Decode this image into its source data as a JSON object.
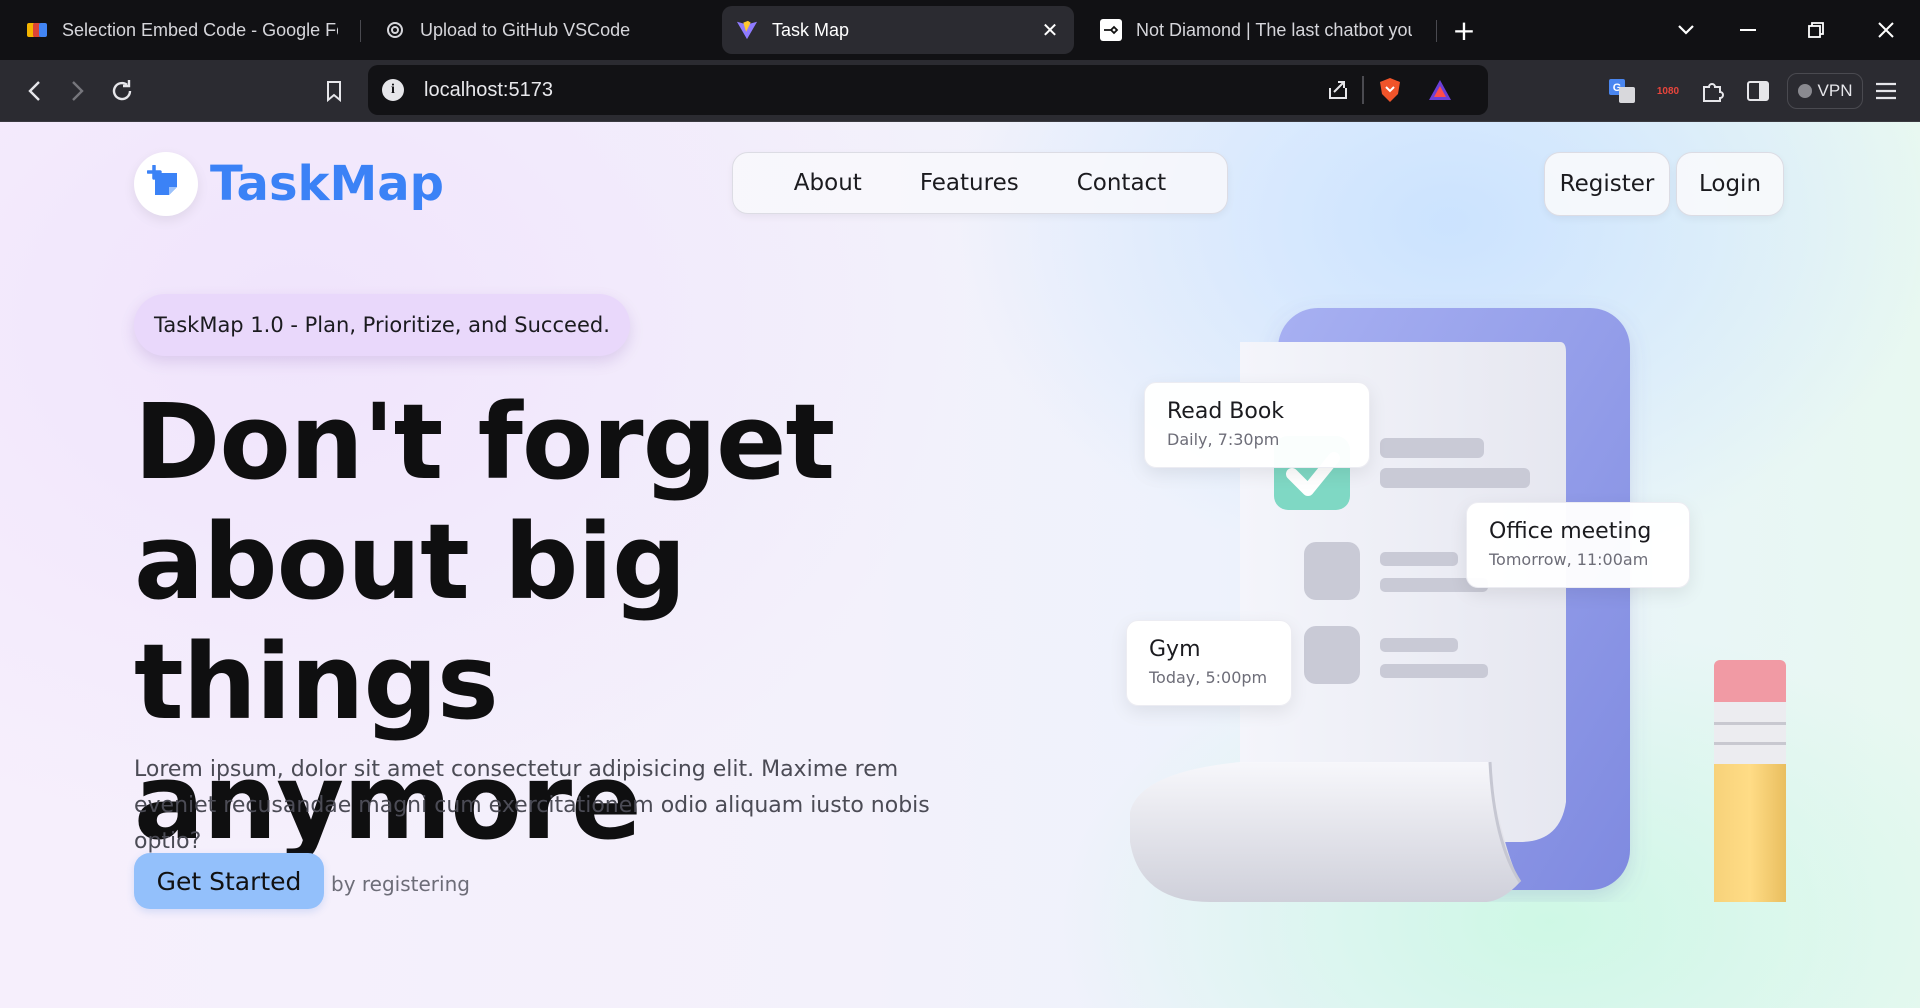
{
  "browser": {
    "tabs": [
      {
        "title": "Selection Embed Code - Google For",
        "favicon": "google-sites-icon",
        "active": false
      },
      {
        "title": "Upload to GitHub VSCode",
        "favicon": "chatgpt-icon",
        "active": false
      },
      {
        "title": "Task Map",
        "favicon": "vite-icon",
        "active": true
      },
      {
        "title": "Not Diamond | The last chatbot you",
        "favicon": "not-diamond-icon",
        "active": false
      }
    ],
    "url": "localhost:5173",
    "vpn_label": "VPN",
    "extension_badge": "1080"
  },
  "site": {
    "logo_text": "TaskMap",
    "nav": {
      "about": "About",
      "features": "Features",
      "contact": "Contact"
    },
    "auth": {
      "register": "Register",
      "login": "Login"
    },
    "hero": {
      "tagline": "TaskMap 1.0 - Plan, Prioritize, and Succeed.",
      "headline_line1": "Don't forget",
      "headline_line2": "about big",
      "headline_line3": "things anymore",
      "subtext": "Lorem ipsum, dolor sit amet consectetur adipisicing elit. Maxime rem eveniet recusandae magni cum exercitationem odio aliquam iusto nobis optio?",
      "cta_label": "Get Started",
      "cta_note": "by registering"
    },
    "tasks": [
      {
        "title": "Read Book",
        "time": "Daily, 7:30pm"
      },
      {
        "title": "Office meeting",
        "time": "Tomorrow, 11:00am"
      },
      {
        "title": "Gym",
        "time": "Today, 5:00pm"
      }
    ]
  },
  "colors": {
    "brand": "#3b82f6",
    "cta": "#93c0fb",
    "tagline_bg": "#e9d8fb",
    "clipboard": "#8c96e6",
    "check": "#7fd8c4"
  }
}
